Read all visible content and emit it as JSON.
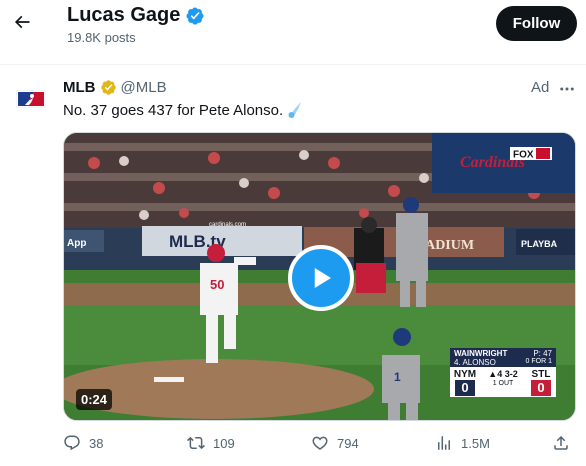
{
  "header": {
    "profile_name": "Lucas Gage",
    "post_count": "19.8K posts",
    "follow_label": "Follow"
  },
  "tweet": {
    "author_name": "MLB",
    "author_handle": "@MLB",
    "ad_label": "Ad",
    "text": "No. 37 goes 437 for Pete Alonso.",
    "video": {
      "duration": "0:24",
      "scorebug": {
        "pitcher": "WAINWRIGHT",
        "pitch_count": "P: 47",
        "batter": "4. ALONSO",
        "batter_line": "0 FOR 1",
        "away_team": "NYM",
        "away_score": "0",
        "inning": "▲4 3-2",
        "outs": "1 OUT",
        "home_team": "STL",
        "home_score": "0"
      }
    },
    "actions": {
      "replies": "38",
      "reposts": "109",
      "likes": "794",
      "views": "1.5M"
    }
  },
  "colors": {
    "accent_blue": "#1d9bf0",
    "verified_gold": "#e2b719",
    "text_primary": "#0f1419",
    "text_secondary": "#536471",
    "mets_blue": "#1d2b4f",
    "cardinals_red": "#c41e3a"
  },
  "icons": {
    "back": "arrow-left-icon",
    "verified": "verified-badge-icon",
    "gold_badge": "gold-check-badge-icon",
    "more": "more-dots-icon",
    "play": "play-icon",
    "reply": "reply-bubble-icon",
    "repost": "repost-icon",
    "like": "heart-icon",
    "views": "bar-chart-icon",
    "share": "share-icon"
  }
}
